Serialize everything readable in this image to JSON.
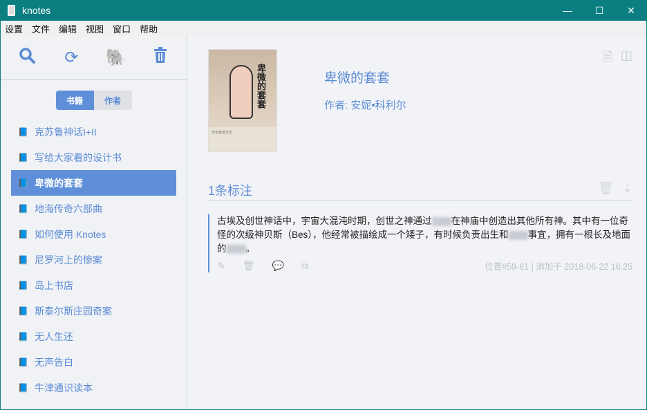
{
  "window": {
    "title": "knotes",
    "minimize": "—",
    "maximize": "☐",
    "close": "✕"
  },
  "menu": [
    "设置",
    "文件",
    "编辑",
    "视图",
    "窗口",
    "帮助"
  ],
  "toolbar": {
    "search": "search",
    "sync": "sync",
    "evernote": "evernote",
    "delete": "delete"
  },
  "segment": {
    "books": "书籍",
    "authors": "作者"
  },
  "books": [
    "克苏鲁神话I+II",
    "写给大家看的设计书",
    "卑微的套套",
    "地海传奇六部曲",
    "如何使用 Knotes",
    "尼罗河上的惨案",
    "岛上书店",
    "斯泰尔斯庄园奇案",
    "无人生还",
    "无声告白",
    "牛津通识读本"
  ],
  "selected_index": 2,
  "book": {
    "title": "卑微的套套",
    "author": "作者: 安妮•科利尔",
    "cover_title": "卑微的套套",
    "cover_subtitle": "安全套进化史"
  },
  "highlights": {
    "heading": "1条标注",
    "note": {
      "text_a": "古埃及创世神话中，宇宙大混沌时期，创世之神通过",
      "text_b": "在神庙中创造出其他所有神。其中有一位奇怪的次级神贝斯（Bes），他经常被描绘成一个矮子，有时候负责出生和",
      "text_c": "事宜，拥有一根长及地面的",
      "text_d": "。",
      "meta": "位置#59-61 | 添加于 2018-06-22 16:25"
    }
  }
}
